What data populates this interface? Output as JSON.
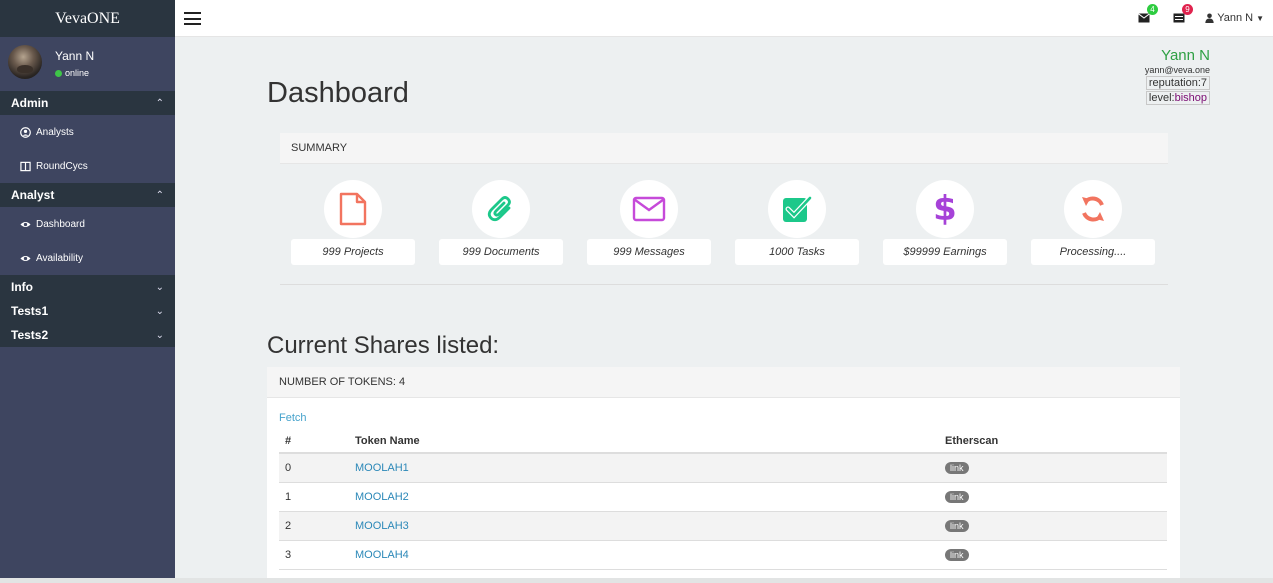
{
  "brand": "VevaONE",
  "sidebar": {
    "user": {
      "name": "Yann N",
      "status": "online"
    },
    "sections": [
      {
        "title": "Admin",
        "expanded": true,
        "items": [
          {
            "label": "Analysts",
            "icon": "user-circle-icon"
          },
          {
            "label": "RoundCycs",
            "icon": "columns-icon"
          }
        ]
      },
      {
        "title": "Analyst",
        "expanded": true,
        "items": [
          {
            "label": "Dashboard",
            "icon": "eye-icon"
          },
          {
            "label": "Availability",
            "icon": "eye-icon"
          }
        ]
      },
      {
        "title": "Info",
        "expanded": false
      },
      {
        "title": "Tests1",
        "expanded": false
      },
      {
        "title": "Tests2",
        "expanded": false
      }
    ]
  },
  "topbar": {
    "mail_badge": "4",
    "mail_badge_color": "#2ecc40",
    "tasks_badge": "9",
    "tasks_badge_color": "#e0234e",
    "user_menu": "Yann N"
  },
  "profile": {
    "name": "Yann N",
    "email": "yann@veva.one",
    "reputation_label": "reputation:",
    "reputation_value": "7",
    "level_label": "level:",
    "level_value": "bishop"
  },
  "page_title": "Dashboard",
  "summary": {
    "header": "SUMMARY",
    "tiles": [
      {
        "label": "999 Projects",
        "icon": "file-icon",
        "color": "#f2745f"
      },
      {
        "label": "999 Documents",
        "icon": "paperclip-icon",
        "color": "#1cc88a"
      },
      {
        "label": "999 Messages",
        "icon": "envelope-icon",
        "color": "#c64ad9"
      },
      {
        "label": "1000 Tasks",
        "icon": "check-square-icon",
        "color": "#1cc88a"
      },
      {
        "label": "$99999 Earnings",
        "icon": "dollar-icon",
        "color": "#a642d8"
      },
      {
        "label": "Processing....",
        "icon": "refresh-icon",
        "color": "#f2745f"
      }
    ]
  },
  "shares": {
    "title": "Current Shares listed:",
    "header": "NUMBER OF TOKENS: 4",
    "fetch": "Fetch",
    "columns": [
      "#",
      "Token Name",
      "Etherscan"
    ],
    "rows": [
      {
        "index": "0",
        "name": "MOOLAH1",
        "link": "link"
      },
      {
        "index": "1",
        "name": "MOOLAH2",
        "link": "link"
      },
      {
        "index": "2",
        "name": "MOOLAH3",
        "link": "link"
      },
      {
        "index": "3",
        "name": "MOOLAH4",
        "link": "link"
      }
    ]
  }
}
